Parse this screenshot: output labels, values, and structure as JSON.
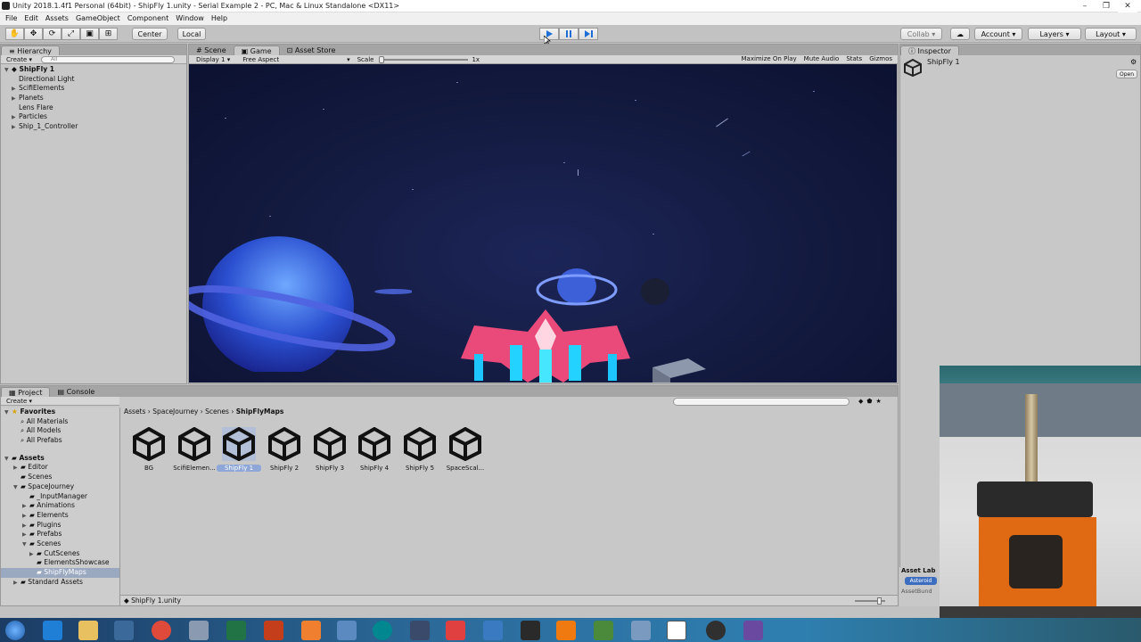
{
  "window": {
    "title": "Unity 2018.1.4f1 Personal (64bit) - ShipFly 1.unity - Serial Example 2 - PC, Mac & Linux Standalone <DX11>",
    "controls": [
      "–",
      "❐",
      "✕"
    ]
  },
  "menu": [
    "File",
    "Edit",
    "Assets",
    "GameObject",
    "Component",
    "Window",
    "Help"
  ],
  "toolbar": {
    "pivot": "Center",
    "space": "Local",
    "collab": "Collab ▾",
    "account": "Account",
    "layers": "Layers",
    "layout": "Layout"
  },
  "hierarchy": {
    "tab": "Hierarchy",
    "create": "Create",
    "search_placeholder": "All",
    "scene": "ShipFly 1",
    "items": [
      "Directional Light",
      "ScifiElements",
      "Planets",
      "Lens Flare",
      "Particles",
      "Ship_1_Controller"
    ]
  },
  "game": {
    "tabs": [
      "Scene",
      "Game",
      "Asset Store"
    ],
    "display": "Display 1",
    "aspect": "Free Aspect",
    "scale_label": "Scale",
    "scale_value": "1x",
    "options": [
      "Maximize On Play",
      "Mute Audio",
      "Stats",
      "Gizmos"
    ]
  },
  "inspector": {
    "tab": "Inspector",
    "object": "ShipFly 1",
    "open": "Open"
  },
  "project": {
    "tabs": [
      "Project",
      "Console"
    ],
    "create": "Create",
    "breadcrumb": [
      "Assets",
      "SpaceJourney",
      "Scenes",
      "ShipFlyMaps"
    ],
    "favorites": {
      "label": "Favorites",
      "items": [
        "All Materials",
        "All Models",
        "All Prefabs"
      ]
    },
    "assets_label": "Assets",
    "tree": [
      {
        "label": "Editor",
        "indent": 1
      },
      {
        "label": "Scenes",
        "indent": 1
      },
      {
        "label": "SpaceJourney",
        "indent": 1
      },
      {
        "label": "_InputManager",
        "indent": 2
      },
      {
        "label": "Animations",
        "indent": 2
      },
      {
        "label": "Elements",
        "indent": 2
      },
      {
        "label": "Plugins",
        "indent": 2
      },
      {
        "label": "Prefabs",
        "indent": 2
      },
      {
        "label": "Scenes",
        "indent": 2
      },
      {
        "label": "CutScenes",
        "indent": 3
      },
      {
        "label": "ElementsShowcase",
        "indent": 3
      },
      {
        "label": "ShipFlyMaps",
        "indent": 3
      },
      {
        "label": "Standard Assets",
        "indent": 0
      }
    ],
    "files": [
      "BG",
      "ScifiElemen...",
      "ShipFly 1",
      "ShipFly 2",
      "ShipFly 3",
      "ShipFly 4",
      "ShipFly 5",
      "SpaceScal..."
    ],
    "selected_file": "ShipFly 1.unity"
  },
  "asset_labels": {
    "title": "Asset Lab",
    "chip": "Asteroid",
    "bundle": "AssetBund"
  }
}
